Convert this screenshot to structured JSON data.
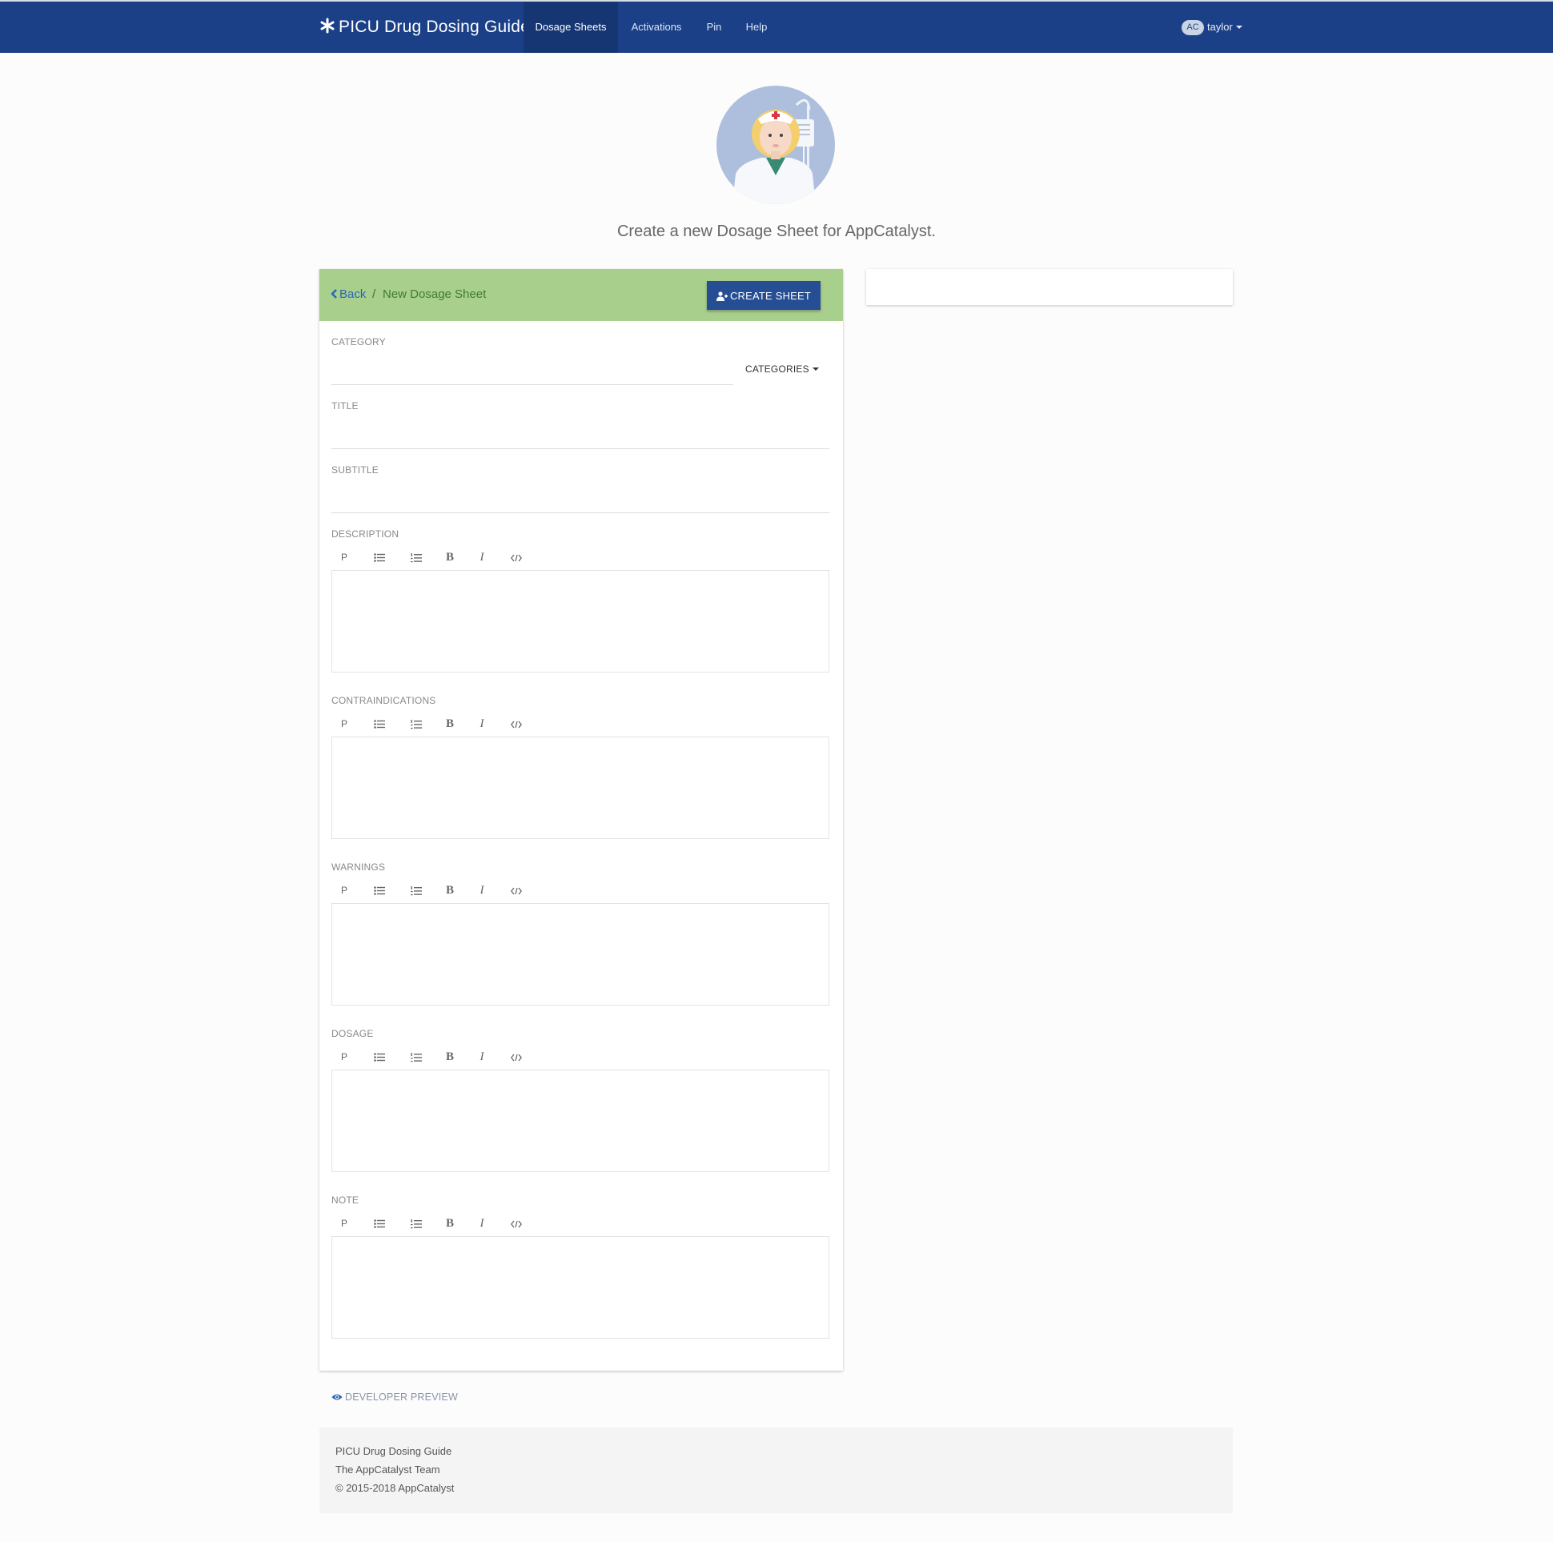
{
  "navbar": {
    "brand": "PICU Drug Dosing Guide",
    "items": [
      {
        "label": "Dosage Sheets",
        "active": true
      },
      {
        "label": "Activations",
        "active": false
      },
      {
        "label": "Pin",
        "active": false
      },
      {
        "label": "Help",
        "active": false
      }
    ],
    "user": {
      "initials": "AC",
      "name": "taylor"
    }
  },
  "hero": {
    "subtitle": "Create a new Dosage Sheet for AppCatalyst."
  },
  "form": {
    "breadcrumb": {
      "back": "Back",
      "separator": "/",
      "current": "New Dosage Sheet"
    },
    "create_button": "CREATE SHEET",
    "category": {
      "label": "CATEGORY",
      "value": "",
      "dropdown": "CATEGORIES"
    },
    "title": {
      "label": "TITLE",
      "value": ""
    },
    "subtitle": {
      "label": "SUBTITLE",
      "value": ""
    },
    "toolbar": {
      "paragraph": "P",
      "bold": "B",
      "italic": "I"
    },
    "sections": [
      {
        "label": "DESCRIPTION"
      },
      {
        "label": "CONTRAINDICATIONS"
      },
      {
        "label": "WARNINGS"
      },
      {
        "label": "DOSAGE"
      },
      {
        "label": "NOTE"
      }
    ]
  },
  "developer_preview": "DEVELOPER PREVIEW",
  "footer": {
    "lines": [
      "PICU Drug Dosing Guide",
      "The AppCatalyst Team",
      "© 2015-2018 AppCatalyst"
    ]
  },
  "colors": {
    "navbar": "#1b4087",
    "card_header": "#a9cf8d",
    "button": "#264e94"
  }
}
